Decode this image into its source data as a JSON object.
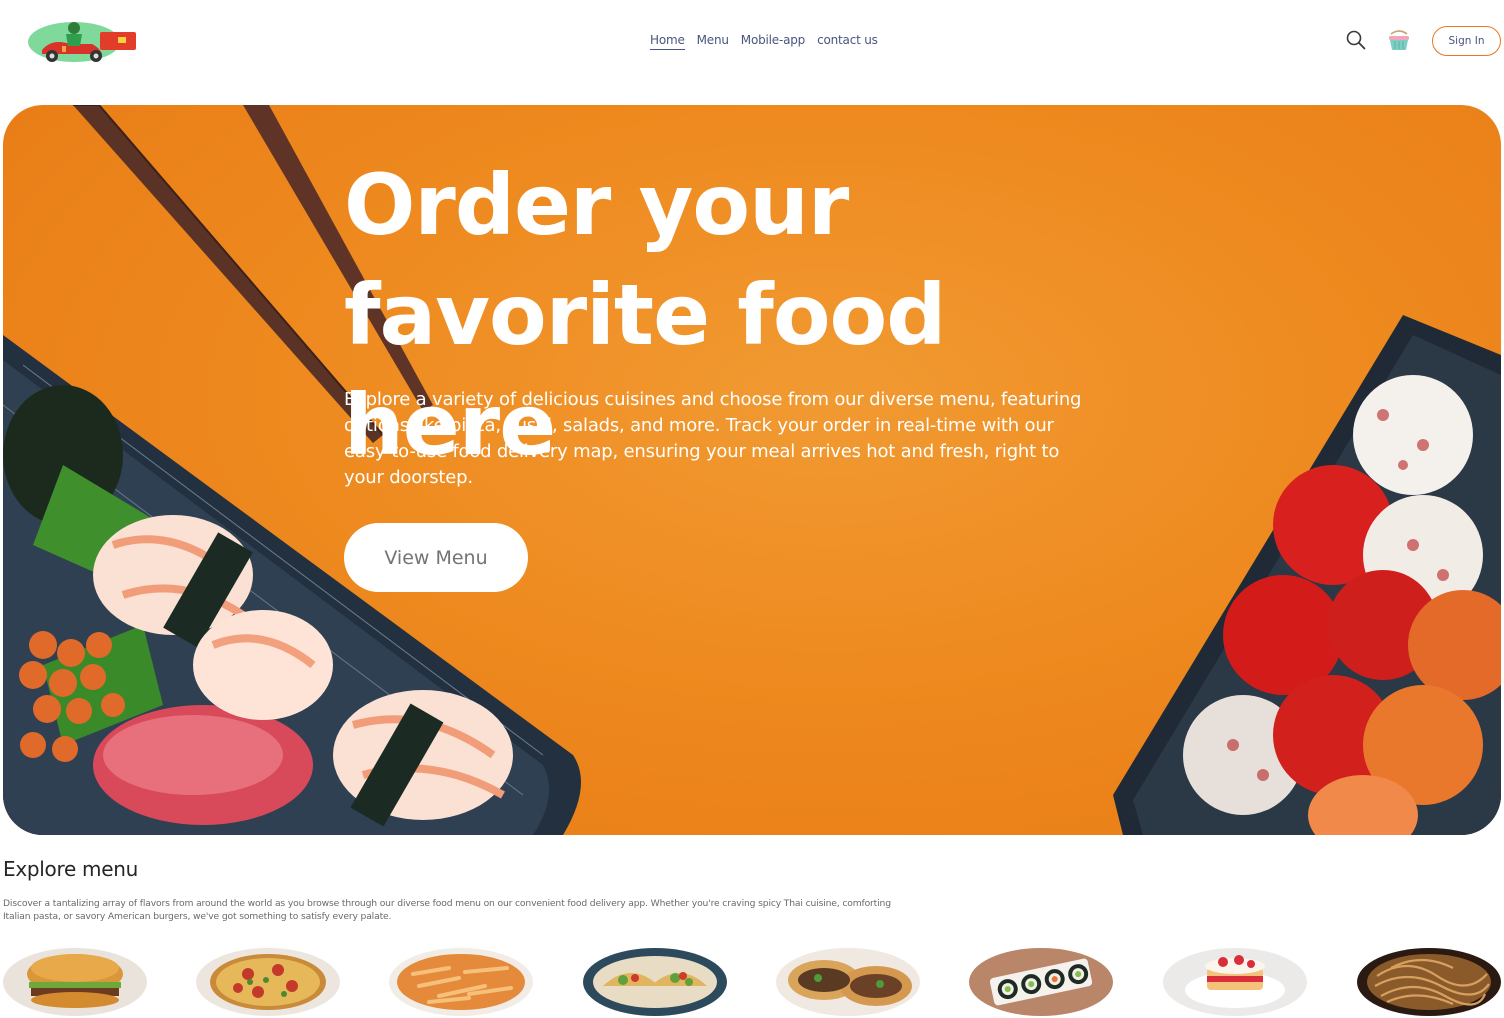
{
  "navbar": {
    "logo_name": "delivery-scooter-logo",
    "links": [
      {
        "label": "Home",
        "active": true
      },
      {
        "label": "Menu",
        "active": false
      },
      {
        "label": "Mobile-app",
        "active": false
      },
      {
        "label": "contact us",
        "active": false
      }
    ],
    "search_icon": "search-icon",
    "basket_icon": "basket-icon",
    "signin_label": "Sign In"
  },
  "hero": {
    "title_line1": "Order your",
    "title_line2": "favorite food here",
    "description": "Explore a variety of delicious cuisines and choose from our diverse menu, featuring options like pizza, sushi, salads, and more. Track your order in real-time with our easy-to-use food delivery map, ensuring your meal arrives hot and fresh, right to your doorstep.",
    "button_label": "View Menu",
    "background_color": "#ee8a1f"
  },
  "explore": {
    "title": "Explore menu",
    "text": "Discover a tantalizing array of flavors from around the world as you browse through our diverse food menu on our convenient food delivery app. Whether you're craving spicy Thai cuisine, comforting Italian pasta, or savory American burgers, we've got something to satisfy every palate.",
    "items": [
      {
        "icon": "burger-icon"
      },
      {
        "icon": "pizza-icon"
      },
      {
        "icon": "pasta-icon"
      },
      {
        "icon": "tacos-icon"
      },
      {
        "icon": "wraps-icon"
      },
      {
        "icon": "sushi-icon"
      },
      {
        "icon": "cake-icon"
      },
      {
        "icon": "noodles-icon"
      }
    ]
  },
  "colors": {
    "accent": "#e67829",
    "nav_text": "#49557e",
    "hero_orange": "#ee8a1f"
  }
}
